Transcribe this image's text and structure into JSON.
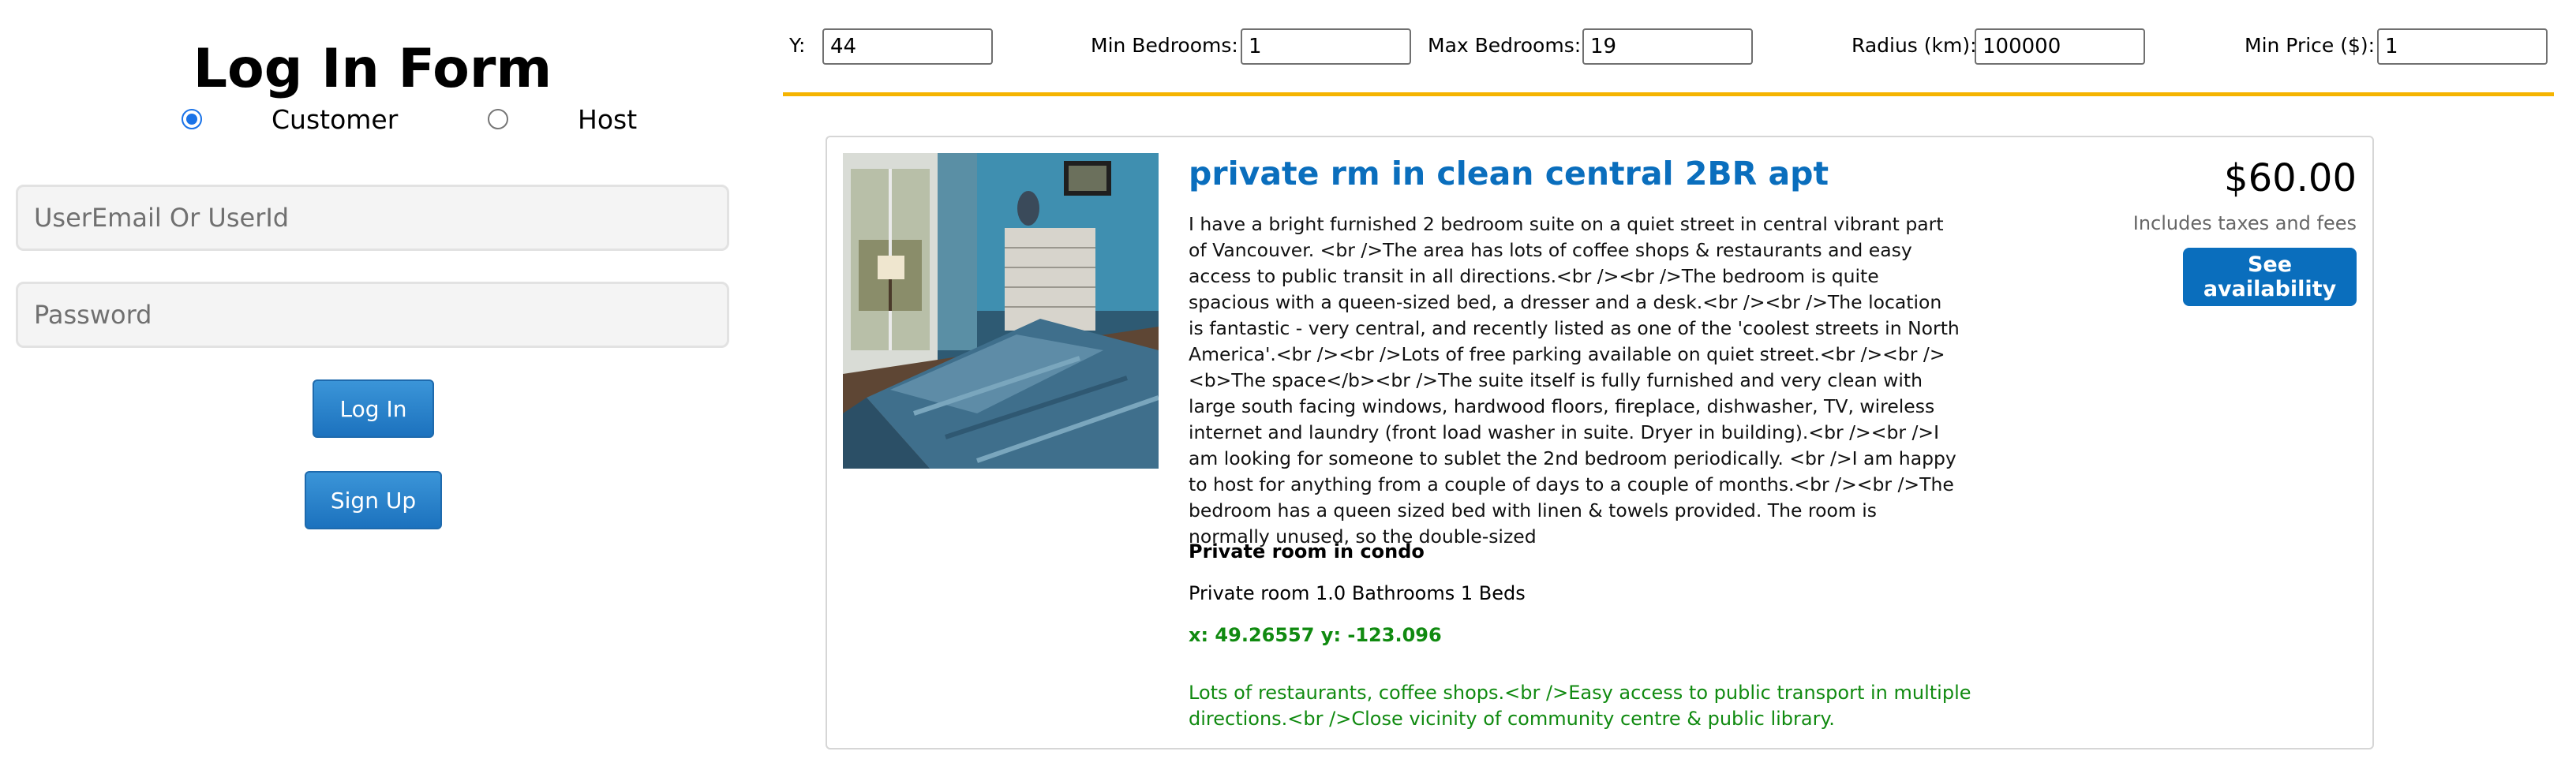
{
  "login": {
    "title": "Log In Form",
    "roles": [
      {
        "label": "Customer",
        "selected": true
      },
      {
        "label": "Host",
        "selected": false
      }
    ],
    "user_placeholder": "UserEmail Or UserId",
    "user_value": "",
    "password_placeholder": "Password",
    "password_value": "",
    "login_label": "Log In",
    "signup_label": "Sign Up"
  },
  "filters": {
    "y_label": "Y:",
    "y_value": "44",
    "min_bedrooms_label": "Min Bedrooms:",
    "min_bedrooms_value": "1",
    "max_bedrooms_label": "Max Bedrooms:",
    "max_bedrooms_value": "19",
    "radius_label": "Radius (km):",
    "radius_value": "100000",
    "min_price_label": "Min Price ($):",
    "min_price_value": "1"
  },
  "listing": {
    "title": "private rm in clean central 2BR apt",
    "description": "I have a bright furnished 2 bedroom suite on a quiet street in central vibrant part of Vancouver. <br />The area has lots of coffee shops & restaurants and easy access to public transit in all directions.<br /><br />The bedroom is quite spacious with a queen-sized bed, a dresser and a desk.<br /><br />The location is fantastic - very central, and recently listed as one of the 'coolest streets in North America'.<br /><br />Lots of free parking available on quiet street.<br /><br /><b>The space</b><br />The suite itself is fully furnished and very clean with large south facing windows, hardwood floors, fireplace, dishwasher, TV, wireless internet and laundry (front load washer in suite. Dryer in building).<br /><br />I am looking for someone to sublet the 2nd bedroom periodically. <br />I am happy to host for anything from a couple of days to a couple of months.<br /><br />The bedroom has a queen sized bed with linen & towels provided. The room is normally unused, so the double-sized",
    "room_type": "Private room in condo",
    "room_summary": "Private room 1.0 Bathrooms 1 Beds",
    "coordinates": "x: 49.26557 y: -123.096",
    "neighborhood": "Lots of restaurants, coffee shops.<br />Easy access to public transport in multiple directions.<br />Close vicinity of community centre & public library.",
    "price": "$60.00",
    "price_note": "Includes taxes and fees",
    "availability_label": "See availability"
  },
  "colors": {
    "accent_blue": "#0a6ebd",
    "rule_gold": "#f5b400",
    "coords_green": "#108a10"
  },
  "icons": {
    "listing_photo": "bedroom-photo"
  }
}
